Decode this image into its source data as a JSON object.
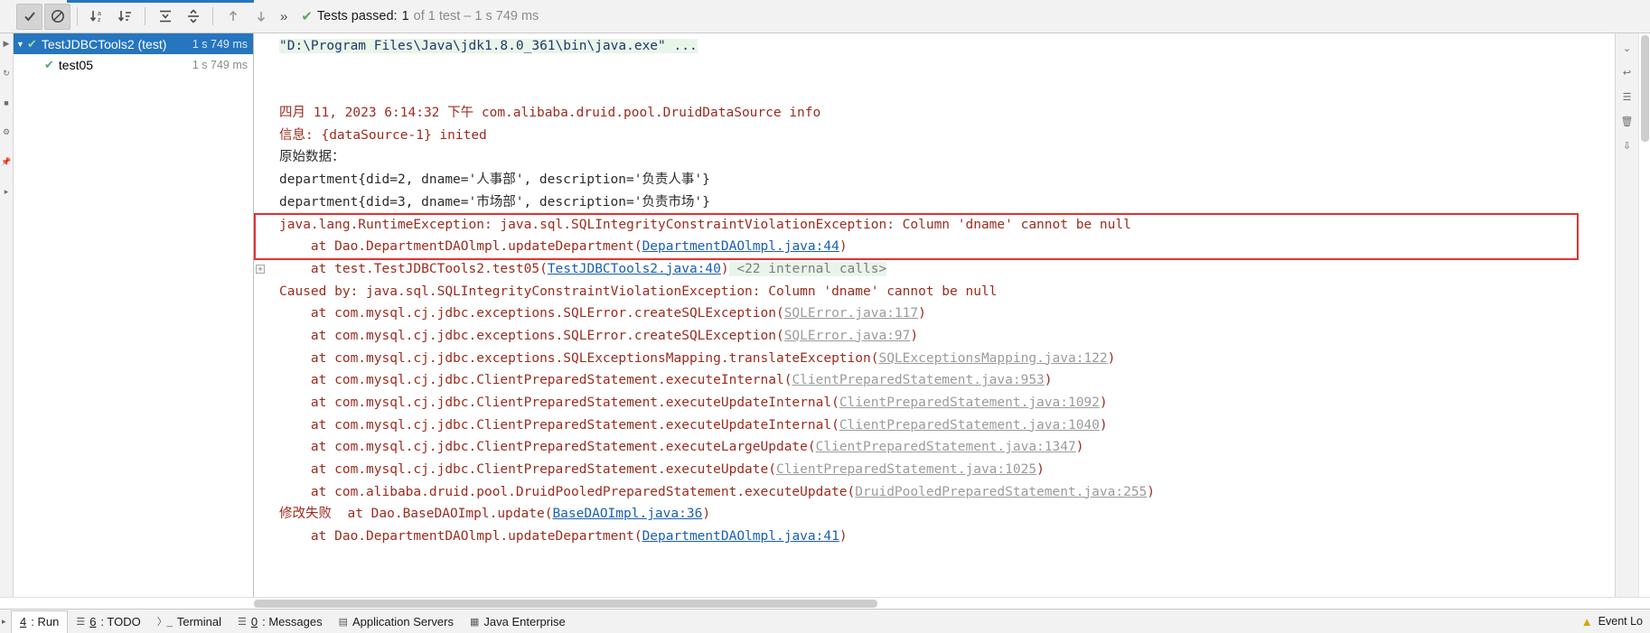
{
  "toolbar": {
    "buttons": [
      {
        "name": "show-passed-button",
        "icon": "check-icon",
        "active": true
      },
      {
        "name": "hide-ignored-button",
        "icon": "block-icon",
        "active": true
      },
      {
        "name": "sort-alphabetically-button",
        "icon": "sort-alpha-icon",
        "active": false
      },
      {
        "name": "sort-by-duration-button",
        "icon": "sort-duration-icon",
        "active": false
      },
      {
        "name": "expand-all-button",
        "icon": "expand-all-icon",
        "active": false
      },
      {
        "name": "collapse-all-button",
        "icon": "collapse-all-icon",
        "active": false
      },
      {
        "name": "previous-failed-button",
        "icon": "arrow-up-icon",
        "active": false
      },
      {
        "name": "next-failed-button",
        "icon": "arrow-down-icon",
        "active": false
      }
    ],
    "more_label": "»",
    "status_prefix": "Tests passed:",
    "status_count": "1",
    "status_suffix": "of 1 test – 1 s 749 ms"
  },
  "tree": {
    "rows": [
      {
        "label": "TestJDBCTools2 (test)",
        "duration": "1 s 749 ms",
        "selected": true,
        "has_arrow": true,
        "indent": false,
        "status_icon": "check-icon"
      },
      {
        "label": "test05",
        "duration": "1 s 749 ms",
        "selected": false,
        "has_arrow": false,
        "indent": true,
        "status_icon": "check-icon"
      }
    ]
  },
  "console": {
    "lines": [
      {
        "segments": [
          {
            "t": "\"D:\\Program Files\\Java\\jdk1.8.0_361\\bin\\java.exe\" ...",
            "c": "c-cmd"
          }
        ]
      },
      {
        "segments": []
      },
      {
        "segments": []
      },
      {
        "segments": [
          {
            "t": "四月 11, 2023 6:14:32 下午 com.alibaba.druid.pool.DruidDataSource info",
            "c": "c-red"
          }
        ]
      },
      {
        "segments": [
          {
            "t": "信息: {dataSource-1} inited",
            "c": "c-red"
          }
        ]
      },
      {
        "segments": [
          {
            "t": "原始数据：",
            "c": "c-dark"
          }
        ]
      },
      {
        "segments": [
          {
            "t": "department{did=2, dname='人事部', description='负责人事'}",
            "c": "c-dark"
          }
        ]
      },
      {
        "segments": [
          {
            "t": "department{did=3, dname='市场部', description='负责市场'}",
            "c": "c-dark"
          }
        ]
      },
      {
        "segments": [
          {
            "t": "java.lang.RuntimeException: java.sql.SQLIntegrityConstraintViolationException: Column 'dname' cannot be null",
            "c": "c-red"
          }
        ]
      },
      {
        "segments": [
          {
            "t": "    at Dao.DepartmentDAOlmpl.updateDepartment(",
            "c": "c-red"
          },
          {
            "t": "DepartmentDAOlmpl.java:44",
            "c": "c-link"
          },
          {
            "t": ")",
            "c": "c-red"
          }
        ]
      },
      {
        "segments": [
          {
            "t": "    at test.TestJDBCTools2.test05(",
            "c": "c-red"
          },
          {
            "t": "TestJDBCTools2.java:40",
            "c": "c-link"
          },
          {
            "t": ")",
            "c": "c-red"
          },
          {
            "t": " <22 internal calls>",
            "c": "c-internal"
          }
        ],
        "fold": true
      },
      {
        "segments": [
          {
            "t": "Caused by: java.sql.SQLIntegrityConstraintViolationException: Column 'dname' cannot be null",
            "c": "c-red"
          }
        ]
      },
      {
        "segments": [
          {
            "t": "    at com.mysql.cj.jdbc.exceptions.SQLError.createSQLException(",
            "c": "c-red"
          },
          {
            "t": "SQLError.java:117",
            "c": "c-graylink"
          },
          {
            "t": ")",
            "c": "c-red"
          }
        ]
      },
      {
        "segments": [
          {
            "t": "    at com.mysql.cj.jdbc.exceptions.SQLError.createSQLException(",
            "c": "c-red"
          },
          {
            "t": "SQLError.java:97",
            "c": "c-graylink"
          },
          {
            "t": ")",
            "c": "c-red"
          }
        ]
      },
      {
        "segments": [
          {
            "t": "    at com.mysql.cj.jdbc.exceptions.SQLExceptionsMapping.translateException(",
            "c": "c-red"
          },
          {
            "t": "SQLExceptionsMapping.java:122",
            "c": "c-graylink"
          },
          {
            "t": ")",
            "c": "c-red"
          }
        ]
      },
      {
        "segments": [
          {
            "t": "    at com.mysql.cj.jdbc.ClientPreparedStatement.executeInternal(",
            "c": "c-red"
          },
          {
            "t": "ClientPreparedStatement.java:953",
            "c": "c-graylink"
          },
          {
            "t": ")",
            "c": "c-red"
          }
        ]
      },
      {
        "segments": [
          {
            "t": "    at com.mysql.cj.jdbc.ClientPreparedStatement.executeUpdateInternal(",
            "c": "c-red"
          },
          {
            "t": "ClientPreparedStatement.java:1092",
            "c": "c-graylink"
          },
          {
            "t": ")",
            "c": "c-red"
          }
        ]
      },
      {
        "segments": [
          {
            "t": "    at com.mysql.cj.jdbc.ClientPreparedStatement.executeUpdateInternal(",
            "c": "c-red"
          },
          {
            "t": "ClientPreparedStatement.java:1040",
            "c": "c-graylink"
          },
          {
            "t": ")",
            "c": "c-red"
          }
        ]
      },
      {
        "segments": [
          {
            "t": "    at com.mysql.cj.jdbc.ClientPreparedStatement.executeLargeUpdate(",
            "c": "c-red"
          },
          {
            "t": "ClientPreparedStatement.java:1347",
            "c": "c-graylink"
          },
          {
            "t": ")",
            "c": "c-red"
          }
        ]
      },
      {
        "segments": [
          {
            "t": "    at com.mysql.cj.jdbc.ClientPreparedStatement.executeUpdate(",
            "c": "c-red"
          },
          {
            "t": "ClientPreparedStatement.java:1025",
            "c": "c-graylink"
          },
          {
            "t": ")",
            "c": "c-red"
          }
        ]
      },
      {
        "segments": [
          {
            "t": "    at com.alibaba.druid.pool.DruidPooledPreparedStatement.executeUpdate(",
            "c": "c-red"
          },
          {
            "t": "DruidPooledPreparedStatement.java:255",
            "c": "c-graylink"
          },
          {
            "t": ")",
            "c": "c-red"
          }
        ]
      },
      {
        "segments": [
          {
            "t": "修改失败  at Dao.BaseDAOImpl.update(",
            "c": "c-red"
          },
          {
            "t": "BaseDAOImpl.java:36",
            "c": "c-link"
          },
          {
            "t": ")",
            "c": "c-red"
          }
        ]
      },
      {
        "segments": [
          {
            "t": "    at Dao.DepartmentDAOlmpl.updateDepartment(",
            "c": "c-red"
          },
          {
            "t": "DepartmentDAOlmpl.java:41",
            "c": "c-link"
          },
          {
            "t": ")",
            "c": "c-red"
          }
        ]
      }
    ]
  },
  "bottom_bar": {
    "items": [
      {
        "name": "tool-window-run",
        "num": "4",
        "label": ": Run",
        "icon": "run-icon",
        "active": true
      },
      {
        "name": "tool-window-todo",
        "num": "6",
        "label": ": TODO",
        "icon": "list-icon",
        "active": false
      },
      {
        "name": "tool-window-terminal",
        "num": "",
        "label": "Terminal",
        "icon": "terminal-icon",
        "active": false
      },
      {
        "name": "tool-window-messages",
        "num": "0",
        "label": ": Messages",
        "icon": "messages-icon",
        "active": false
      },
      {
        "name": "tool-window-application-servers",
        "num": "",
        "label": "Application Servers",
        "icon": "server-icon",
        "active": false
      },
      {
        "name": "tool-window-java-enterprise",
        "num": "",
        "label": "Java Enterprise",
        "icon": "java-ee-icon",
        "active": false
      }
    ],
    "event_log_label": "Event Lo"
  },
  "colors": {
    "selection_blue": "#2675bf",
    "error_red": "#9c2b1e",
    "highlight_box_red": "#e8312f",
    "link_blue": "#1a5fb4",
    "success_green": "#59a869",
    "command_bg": "#e9f5e9"
  }
}
